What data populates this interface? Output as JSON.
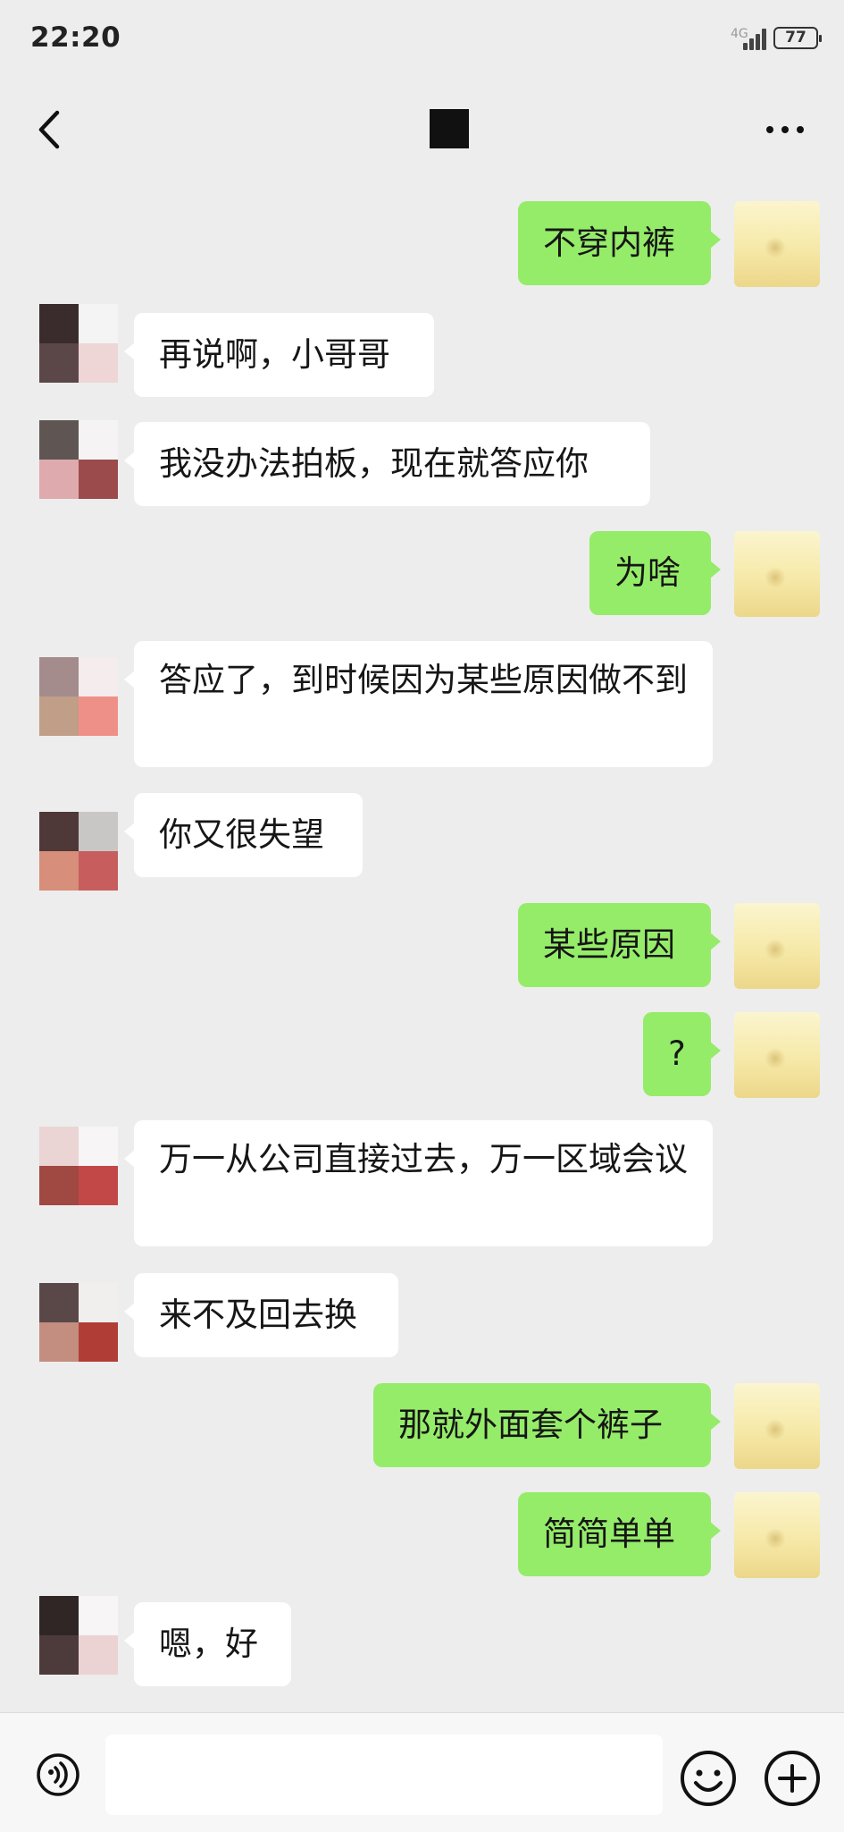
{
  "status_bar": {
    "time": "22:20",
    "network": "4G",
    "battery": "77"
  },
  "nav": {
    "back_icon": "chevron-left-icon",
    "more_icon": "more-dots-icon"
  },
  "messages": [
    {
      "side": "out",
      "text": "不穿内裤"
    },
    {
      "side": "in",
      "text": "再说啊，小哥哥"
    },
    {
      "side": "in",
      "text": "我没办法拍板，现在就答应你"
    },
    {
      "side": "out",
      "text": "为啥"
    },
    {
      "side": "in",
      "text": "答应了，到时候因为某些原因做不到"
    },
    {
      "side": "in",
      "text": "你又很失望"
    },
    {
      "side": "out",
      "text": "某些原因"
    },
    {
      "side": "out",
      "text": "?"
    },
    {
      "side": "in",
      "text": "万一从公司直接过去，万一区域会议"
    },
    {
      "side": "in",
      "text": "来不及回去换"
    },
    {
      "side": "out",
      "text": "那就外面套个裤子"
    },
    {
      "side": "out",
      "text": "简简单单"
    },
    {
      "side": "in",
      "text": "嗯，好"
    }
  ],
  "colors": {
    "outgoing_bubble": "#95ec69",
    "incoming_bubble": "#ffffff",
    "background": "#ededed"
  },
  "input_bar": {
    "voice_icon": "voice-icon",
    "emoji_icon": "emoji-icon",
    "plus_icon": "plus-icon",
    "value": ""
  }
}
